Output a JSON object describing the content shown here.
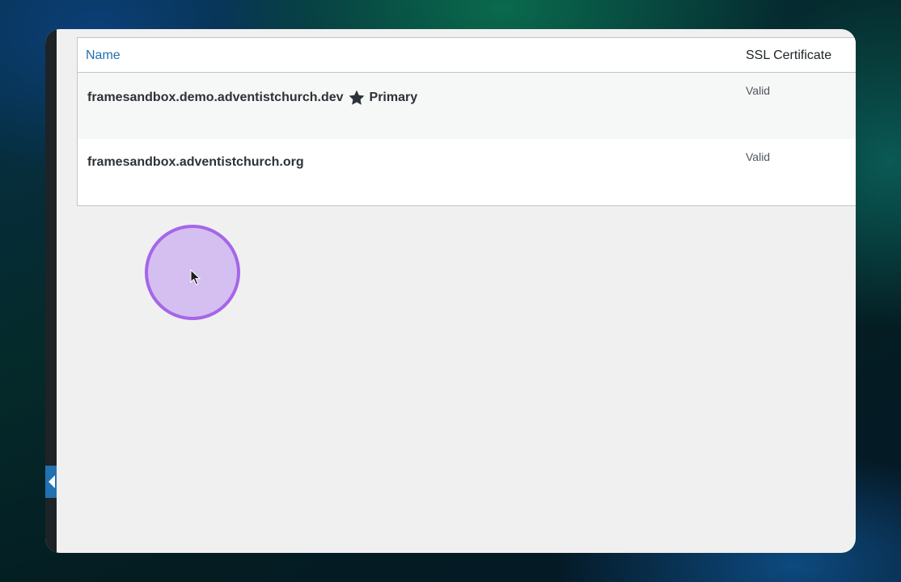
{
  "table": {
    "headers": {
      "name": "Name",
      "ssl": "SSL Certificate"
    },
    "rows": [
      {
        "domain": "framesandbox.demo.adventistchurch.dev",
        "primary_label": "Primary",
        "ssl_status": "Valid"
      },
      {
        "domain": "framesandbox.adventistchurch.org",
        "ssl_status": "Valid"
      }
    ]
  },
  "colors": {
    "link": "#2271b1",
    "page_bg": "#f0f0f1",
    "sidebar": "#1d2327",
    "cursor_ring": "#a566e8"
  },
  "icons": {
    "primary_marker": "star-icon",
    "sidebar_toggle": "collapse-arrow-icon",
    "cursor": "mouse-pointer-icon"
  }
}
